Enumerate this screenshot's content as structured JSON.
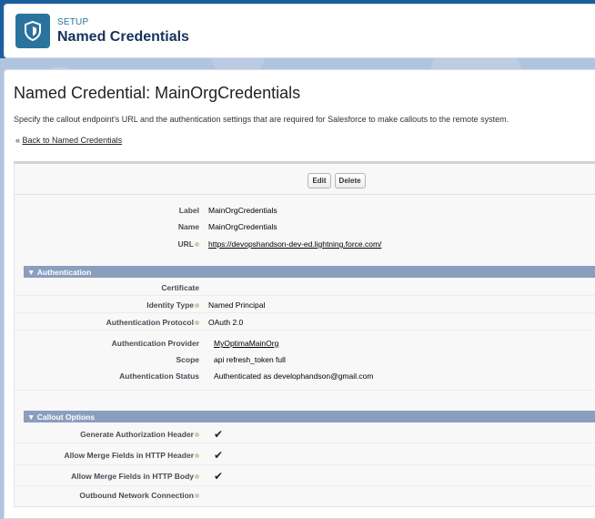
{
  "header": {
    "setup_label": "SETUP",
    "title": "Named Credentials",
    "icon": "setup-shield-icon"
  },
  "page": {
    "title": "Named Credential: MainOrgCredentials",
    "description": "Specify the callout endpoint's URL and the authentication settings that are required for Salesforce to make callouts to the remote system.",
    "back_prefix": "«",
    "back_link": "Back to Named Credentials"
  },
  "buttons": {
    "edit": "Edit",
    "delete": "Delete"
  },
  "details": {
    "label_label": "Label",
    "label_value": "MainOrgCredentials",
    "name_label": "Name",
    "name_value": "MainOrgCredentials",
    "url_label": "URL",
    "url_value": "https://devopshandson-dev-ed.lightning.force.com/"
  },
  "authentication": {
    "section_title": "Authentication",
    "certificate_label": "Certificate",
    "certificate_value": "",
    "identity_type_label": "Identity Type",
    "identity_type_value": "Named Principal",
    "protocol_label": "Authentication Protocol",
    "protocol_value": "OAuth 2.0",
    "provider_label": "Authentication Provider",
    "provider_value": "MyOptimaMainOrg",
    "scope_label": "Scope",
    "scope_value": "api refresh_token full",
    "status_label": "Authentication Status",
    "status_value": "Authenticated as develophandson@gmail.com"
  },
  "callout": {
    "section_title": "Callout Options",
    "gen_auth_header_label": "Generate Authorization Header",
    "gen_auth_header_checked": true,
    "merge_header_label": "Allow Merge Fields in HTTP Header",
    "merge_header_checked": true,
    "merge_body_label": "Allow Merge Fields in HTTP Body",
    "merge_body_checked": true,
    "outbound_label": "Outbound Network Connection",
    "outbound_value": ""
  },
  "colors": {
    "section_header_bg": "#8a9ebe",
    "brand_blue": "#2a739e",
    "header_bg": "#1b5f9e"
  }
}
